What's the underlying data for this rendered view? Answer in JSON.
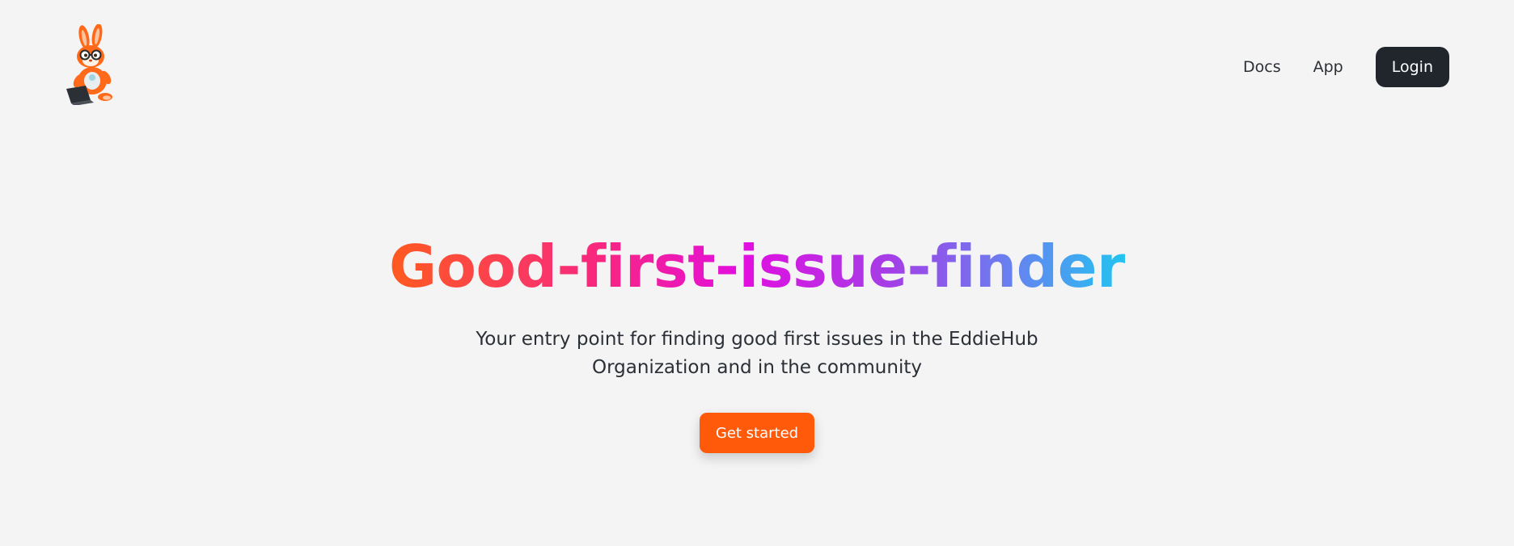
{
  "header": {
    "logo_icon": "bunny-mascot-with-laptop-icon",
    "nav": [
      {
        "label": "Docs"
      },
      {
        "label": "App"
      }
    ],
    "login_label": "Login"
  },
  "hero": {
    "title": "Good-first-issue-finder",
    "subtitle": "Your entry point for finding good first issues in the EddieHub Organization and in the community",
    "cta_label": "Get started"
  },
  "colors": {
    "background": "#f4f4f4",
    "accent": "#ff5a0a",
    "dark_button": "#21262d",
    "title_gradient": [
      "#ff5a1f",
      "#f72585",
      "#e20ee0",
      "#a43ee6",
      "#6a7ff0",
      "#22c4f0"
    ]
  }
}
